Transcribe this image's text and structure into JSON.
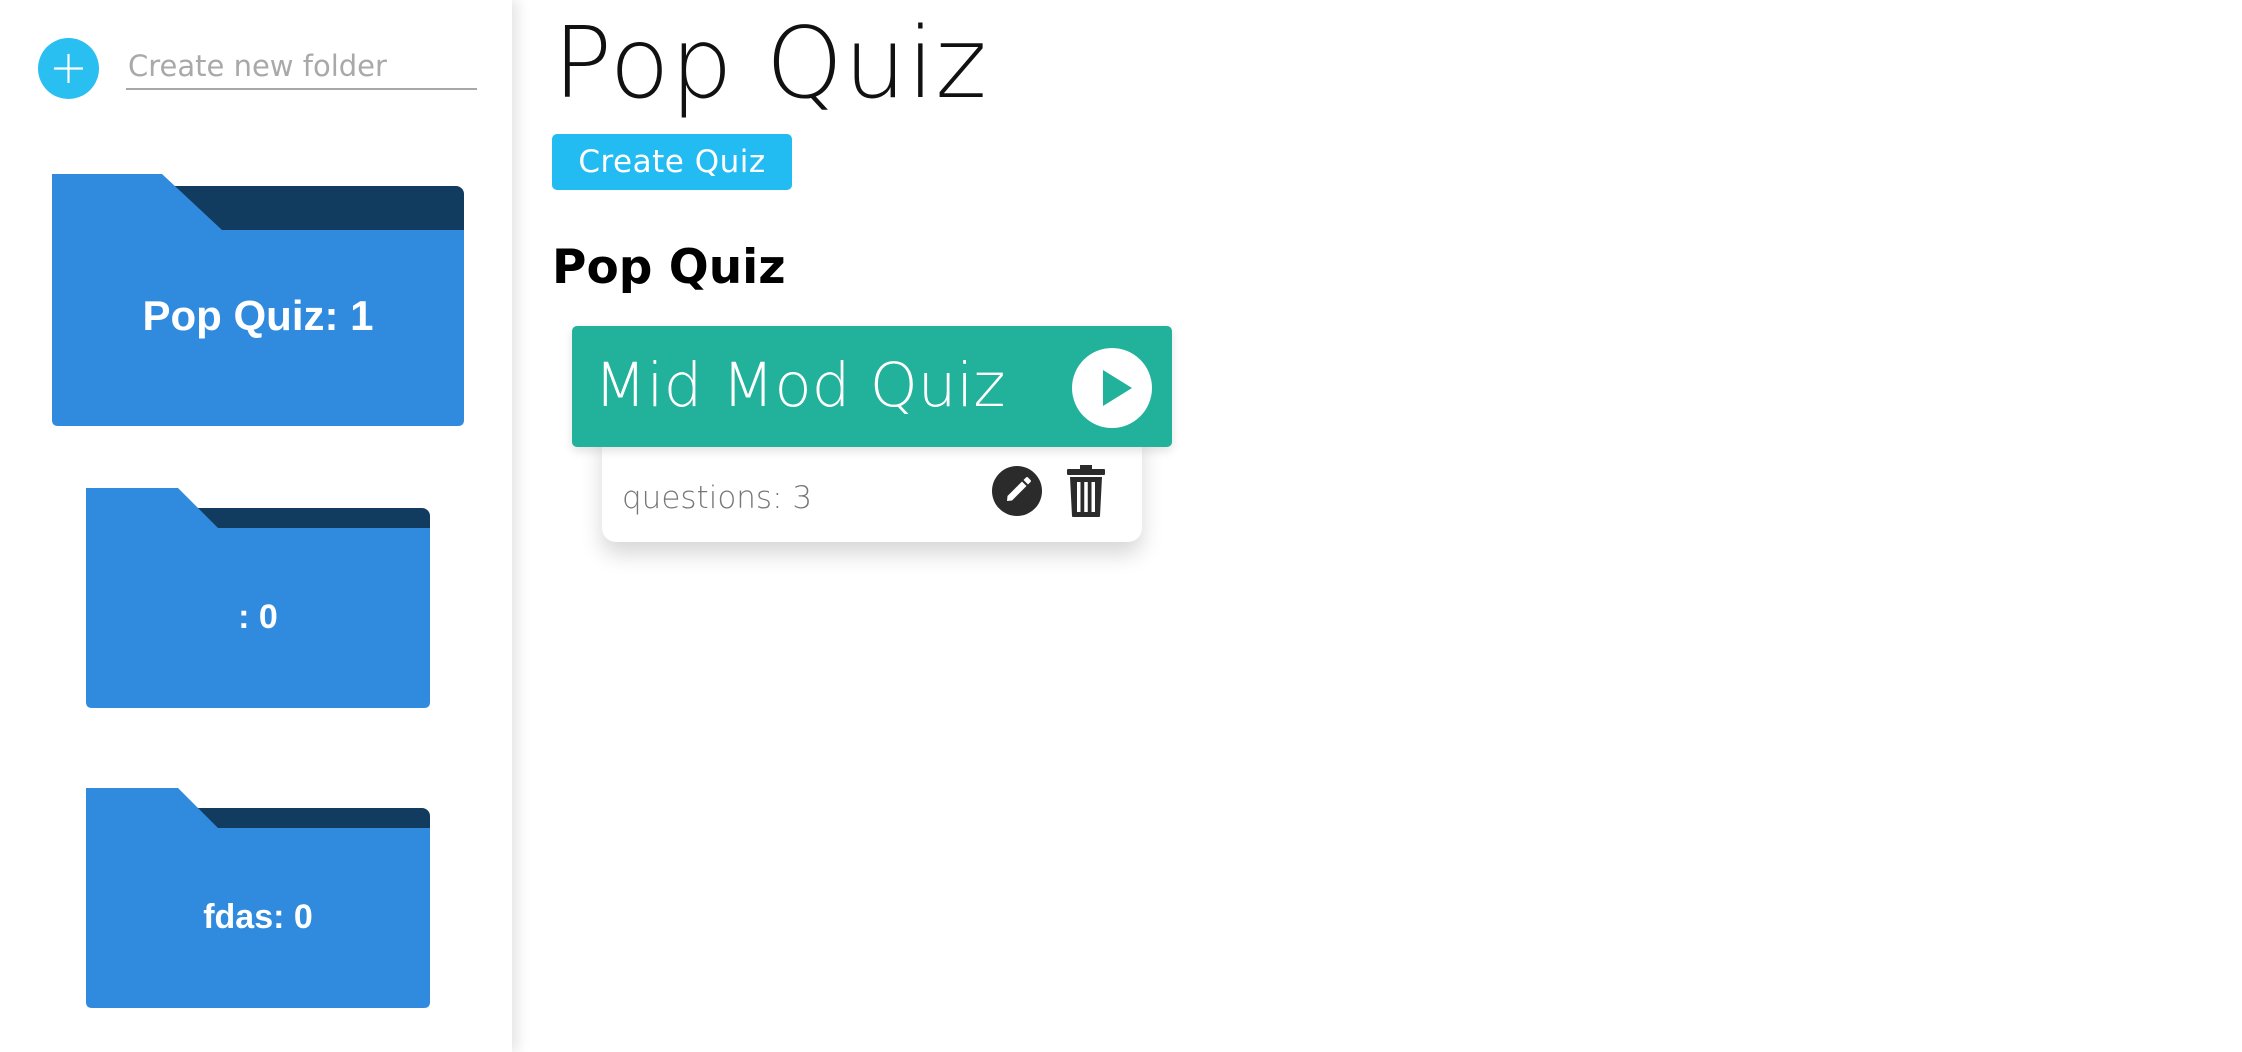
{
  "sidebar": {
    "new_folder_placeholder": "Create new folder",
    "new_folder_value": "",
    "folders": [
      {
        "label": "Pop Quiz: 1"
      },
      {
        "label": ": 0"
      },
      {
        "label": "fdas: 0"
      }
    ]
  },
  "main": {
    "title": "Pop Quiz",
    "create_quiz_label": "Create Quiz",
    "section_heading": "Pop Quiz",
    "quizzes": [
      {
        "name": "Mid Mod Quiz",
        "questions_text": "questions: 3"
      }
    ]
  },
  "colors": {
    "accent": "#23bcf2",
    "folder_front": "#308bde",
    "folder_back": "#123b60",
    "quiz_header": "#22b19b"
  },
  "icons": {
    "add_folder": "plus-icon",
    "play": "play-icon",
    "edit": "pencil-icon",
    "delete": "trash-icon",
    "folder": "folder-icon"
  }
}
